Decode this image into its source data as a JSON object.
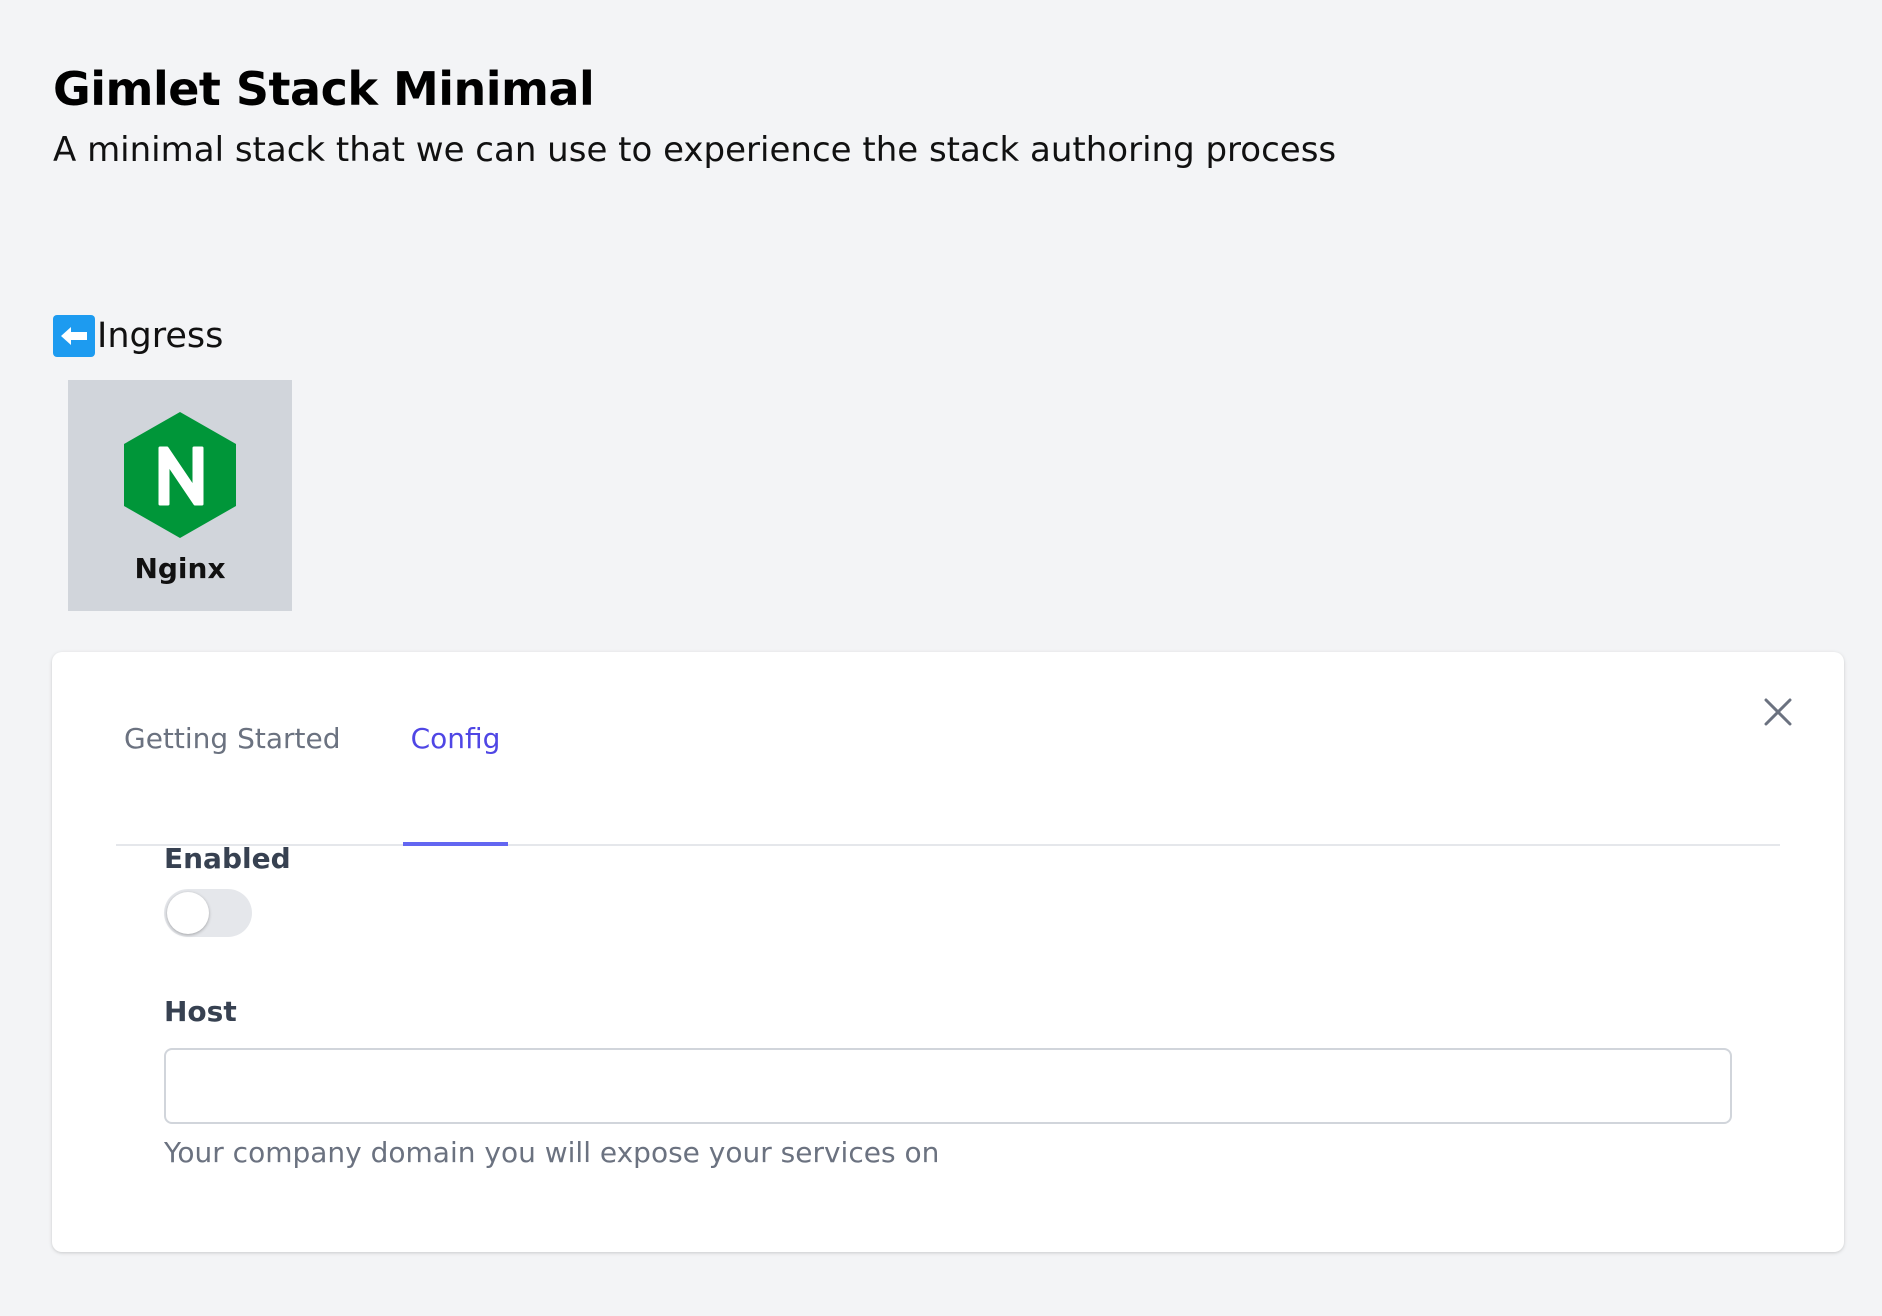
{
  "header": {
    "title": "Gimlet Stack Minimal",
    "description": "A minimal stack that we can use to experience the stack authoring process"
  },
  "section": {
    "label": "Ingress",
    "icon": "left-arrow-emoji-icon"
  },
  "components": [
    {
      "label": "Nginx",
      "icon": "nginx-logo-icon",
      "letter": "N",
      "color": "#009639",
      "selected": true
    }
  ],
  "panel": {
    "tabs": [
      {
        "label": "Getting Started",
        "active": false
      },
      {
        "label": "Config",
        "active": true
      }
    ],
    "fields": {
      "enabled": {
        "label": "Enabled",
        "value": false
      },
      "host": {
        "label": "Host",
        "value": "",
        "help": "Your company domain you will expose your services on"
      }
    },
    "close_icon": "close-icon"
  },
  "colors": {
    "accent": "#4f46e5",
    "nginx_green": "#009639",
    "page_bg": "#f3f4f6"
  }
}
